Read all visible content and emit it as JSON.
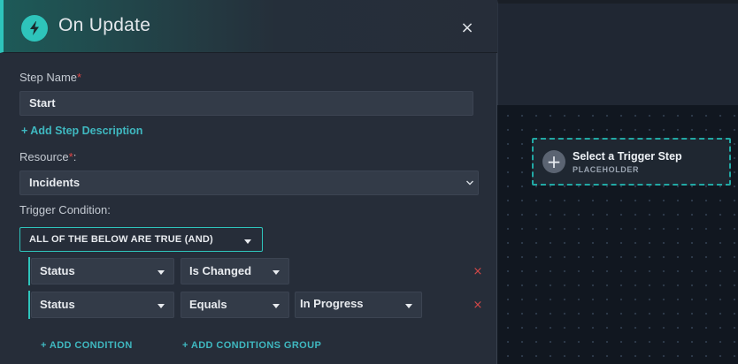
{
  "panel": {
    "title": "On Update",
    "icon": "lightning-icon",
    "close_glyph": "×",
    "accent": "#2ec4bb"
  },
  "form": {
    "step_name_label": "Step Name",
    "step_name_required": "*",
    "step_name_value": "Start",
    "add_description": "+ Add Step Description",
    "resource_label": "Resource",
    "resource_required": "*",
    "resource_colon": ":",
    "resource_value": "Incidents",
    "trigger_condition_label": "Trigger Condition:",
    "condition_group_value": "ALL OF THE BELOW ARE TRUE (AND)"
  },
  "conditions": [
    {
      "field": "Status",
      "operator": "Is Changed",
      "value": ""
    },
    {
      "field": "Status",
      "operator": "Equals",
      "value": "In Progress"
    }
  ],
  "actions": {
    "add_condition": "+ ADD CONDITION",
    "add_conditions_group": "+ ADD CONDITIONS GROUP",
    "remove_glyph": "×"
  },
  "canvas": {
    "trigger_title": "Select a Trigger Step",
    "trigger_subtitle": "PLACEHOLDER",
    "trigger_border": "#21a8a4"
  }
}
